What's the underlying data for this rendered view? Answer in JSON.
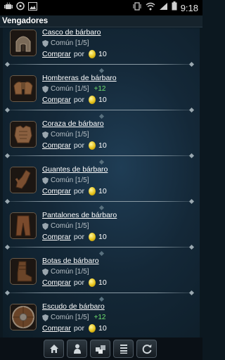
{
  "status_bar": {
    "time": "9:18",
    "left_icons": [
      "android-icon",
      "circle-app-icon",
      "image-icon"
    ],
    "right_icons": [
      "vibrate-icon",
      "wifi-icon",
      "signal-icon",
      "battery-icon"
    ]
  },
  "title": "Vengadores",
  "buy_label": "Comprar",
  "por_label": "por",
  "items": [
    {
      "name": "Casco de bárbaro",
      "rarity": "Común [1/5]",
      "bonus": "",
      "price": "10",
      "icon": "helmet-icon"
    },
    {
      "name": "Hombreras de bárbaro",
      "rarity": "Común [1/5]",
      "bonus": "+12",
      "price": "10",
      "icon": "shoulder-pads-icon"
    },
    {
      "name": "Coraza de bárbaro",
      "rarity": "Común [1/5]",
      "bonus": "",
      "price": "10",
      "icon": "chest-armor-icon"
    },
    {
      "name": "Guantes de bárbaro",
      "rarity": "Común [1/5]",
      "bonus": "",
      "price": "10",
      "icon": "gloves-icon"
    },
    {
      "name": "Pantalones de bárbaro",
      "rarity": "Común [1/5]",
      "bonus": "",
      "price": "10",
      "icon": "pants-icon"
    },
    {
      "name": "Botas de bárbaro",
      "rarity": "Común [1/5]",
      "bonus": "",
      "price": "10",
      "icon": "boots-icon"
    },
    {
      "name": "Escudo de bárbaro",
      "rarity": "Común [1/5]",
      "bonus": "+12",
      "price": "10",
      "icon": "shield-item-icon"
    }
  ],
  "bottom_nav": [
    "home-icon",
    "profile-icon",
    "inventory-icon",
    "list-icon",
    "refresh-icon"
  ],
  "colors": {
    "background": "#0c1820",
    "bonus": "#6fe06f",
    "coin": "#e6c21a",
    "title_bar": "#16232c"
  }
}
